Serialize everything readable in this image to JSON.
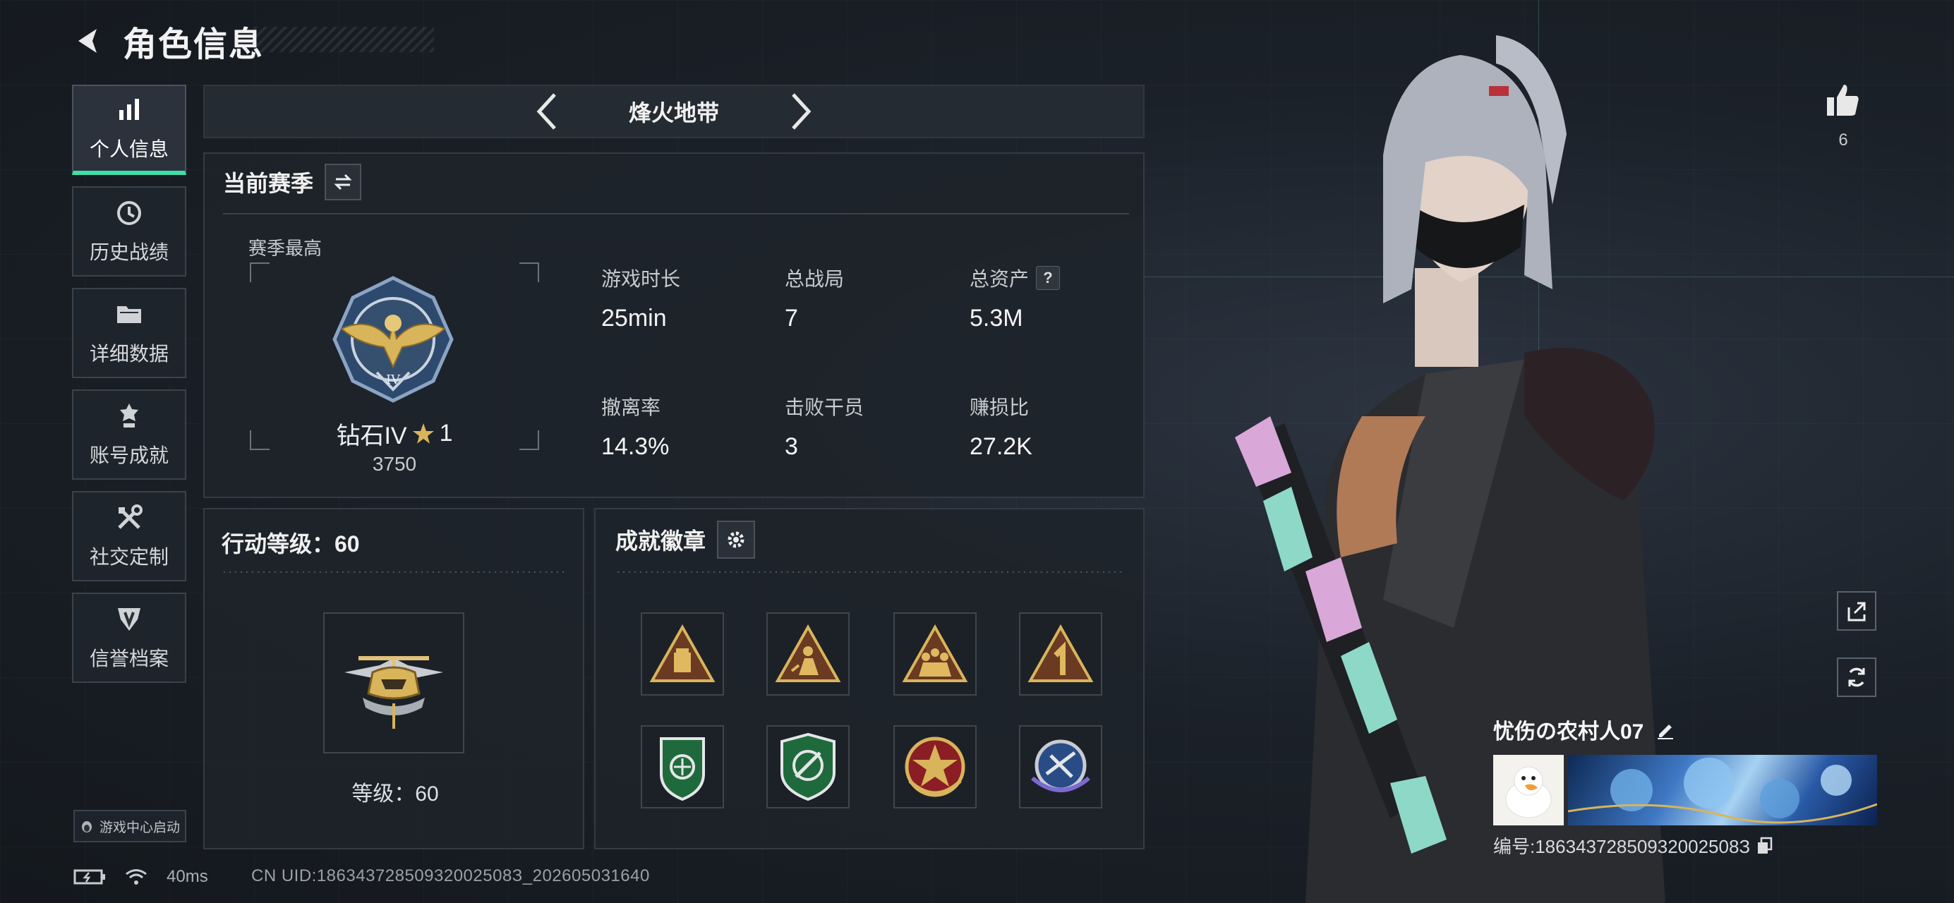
{
  "header": {
    "title": "角色信息"
  },
  "sidebar": {
    "items": [
      {
        "label": "个人信息",
        "icon": "bar-chart-icon",
        "active": true
      },
      {
        "label": "历史战绩",
        "icon": "history-clock-icon"
      },
      {
        "label": "详细数据",
        "icon": "folder-icon"
      },
      {
        "label": "账号成就",
        "icon": "medal-icon"
      },
      {
        "label": "社交定制",
        "icon": "tools-icon"
      },
      {
        "label": "信誉档案",
        "icon": "shield-icon"
      }
    ],
    "game_center": "游戏中心启动"
  },
  "mode": {
    "name": "烽火地带"
  },
  "season": {
    "title": "当前赛季",
    "best_label": "赛季最高",
    "rank": {
      "name": "钻石IV",
      "stars": "1",
      "score": "3750"
    },
    "stats": [
      {
        "label": "游戏时长",
        "value": "25min"
      },
      {
        "label": "总战局",
        "value": "7"
      },
      {
        "label": "总资产",
        "value": "5.3M",
        "help": "?"
      },
      {
        "label": "撤离率",
        "value": "14.3%"
      },
      {
        "label": "击败干员",
        "value": "3"
      },
      {
        "label": "赚损比",
        "value": "27.2K"
      }
    ]
  },
  "level": {
    "title": "行动等级：60",
    "label": "等级：60"
  },
  "badges": {
    "title": "成就徽章",
    "items": [
      "triangle-crate-badge",
      "triangle-soldier-badge",
      "triangle-squad-badge",
      "triangle-number-one-badge",
      "green-shield-badge",
      "green-crosshair-badge",
      "star-wreath-badge",
      "blue-wings-badge"
    ]
  },
  "status": {
    "ping": "40ms",
    "uid": "CN UID:18634372850932002508З_202605031640"
  },
  "profile": {
    "likes": "6",
    "name": "忧伤の农村人07",
    "id": "编号:18634372850932002508З"
  },
  "colors": {
    "accent": "#3fe0a8",
    "gold": "#d8b45a"
  }
}
